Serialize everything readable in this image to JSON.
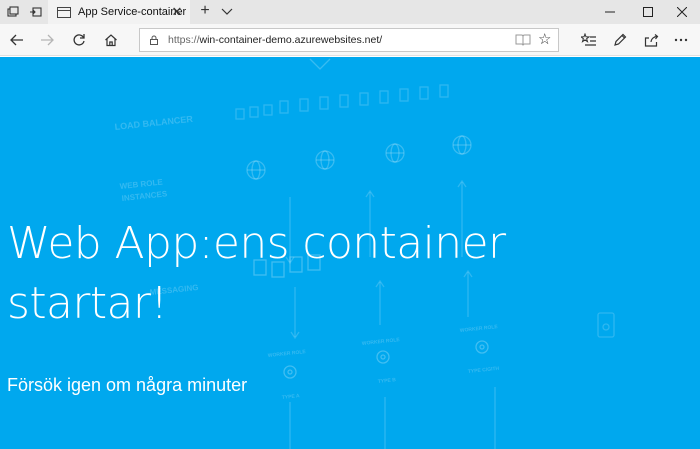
{
  "browser": {
    "tab": {
      "title": "App Service-container"
    },
    "address_bar": {
      "protocol": "https://",
      "host": "win-container-demo.azurewebsites.net/"
    }
  },
  "page": {
    "headline": "Web App:ens container startar!",
    "subline": "Försök igen om några minuter",
    "background_color": "#00a8ee",
    "background_labels": {
      "load_balancer": "LOAD BALANCER",
      "web_role_line1": "WEB ROLE",
      "web_role_line2": "INSTANCES",
      "messaging": "MESSAGING",
      "worker_role": "WORKER ROLE",
      "type_a": "TYPE A",
      "type_b": "TYPE B",
      "type_c": "TYPE C/GITH"
    }
  }
}
